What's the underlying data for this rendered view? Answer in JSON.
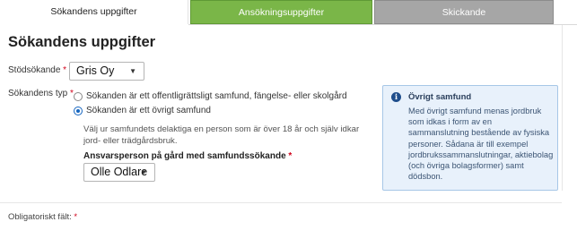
{
  "tabs": [
    {
      "label": "Sökandens uppgifter"
    },
    {
      "label": "Ansökningsuppgifter"
    },
    {
      "label": "Skickande"
    }
  ],
  "page_title": "Sökandens uppgifter",
  "applicant": {
    "label": "Stödsökande",
    "required_mark": "*",
    "value": "Gris Oy"
  },
  "type": {
    "label": "Sökandens typ",
    "required_mark": "*",
    "options": [
      {
        "label": "Sökanden är ett offentligrättsligt samfund, fängelse- eller skolgård",
        "selected": false
      },
      {
        "label": "Sökanden är ett övrigt samfund",
        "selected": true
      }
    ],
    "help_text": "Välj ur samfundets delaktiga en person som är över 18 år och själv idkar jord- eller trädgårdsbruk."
  },
  "responsible": {
    "label": "Ansvarsperson på gård med samfundssökande",
    "required_mark": "*",
    "value": "Olle Odlare"
  },
  "info": {
    "icon": "info-icon",
    "title": "Övrigt samfund",
    "body": "Med övrigt samfund menas jordbruk som idkas i form av en sammanslutning bestående av fysiska personer. Sådana är till exempel jordbrukssammanslutningar, aktiebolag (och övriga bolagsformer) samt dödsbon."
  },
  "footer": {
    "label": "Obligatoriskt fält:",
    "required_mark": "*"
  },
  "colors": {
    "tab_green": "#7ab648",
    "tab_gray": "#a6a6a6",
    "info_bg": "#e8f1fb",
    "required": "#d0021b"
  }
}
